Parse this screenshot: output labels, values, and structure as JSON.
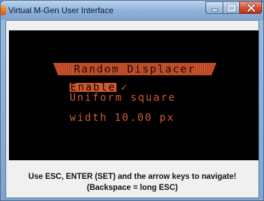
{
  "window": {
    "title": "Virtual M-Gen User Interface"
  },
  "controls": {
    "minimize_icon": "minimize-icon",
    "maximize_icon": "maximize-icon",
    "close_icon": "close-icon"
  },
  "menu": {
    "header": "Random Displacer",
    "enable_label": "Enable",
    "enable_check": "✓",
    "mode": "Uniform square",
    "width_label": "width",
    "width_value": "10.00",
    "width_unit": "px"
  },
  "instructions": {
    "line1": "Use ESC, ENTER (SET) and the arrow keys to navigate!",
    "line2": "(Backspace = long ESC)"
  },
  "colors": {
    "lcd_orange": "#d05a30",
    "screen_bg": "#000000",
    "close_red": "#c22e14"
  }
}
